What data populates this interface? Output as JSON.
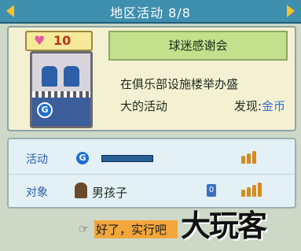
{
  "header": {
    "title": "地区活动 8/8"
  },
  "activity": {
    "value": "10",
    "name": "球迷感谢会",
    "description_line1": "在俱乐部设施楼举办盛",
    "description_line2": "大的活动",
    "discovery_label": "发现:",
    "discovery_value": "金币",
    "image_icon_letter": "G"
  },
  "details": {
    "rows": [
      {
        "label": "活动",
        "icon": "G",
        "bar_level": 0.85
      },
      {
        "label": "对象",
        "icon": "boy-avatar-icon",
        "value": "男孩子",
        "badge": "0"
      }
    ]
  },
  "confirm": {
    "label": "好了，实行吧"
  },
  "watermark": {
    "text": "大玩客"
  }
}
